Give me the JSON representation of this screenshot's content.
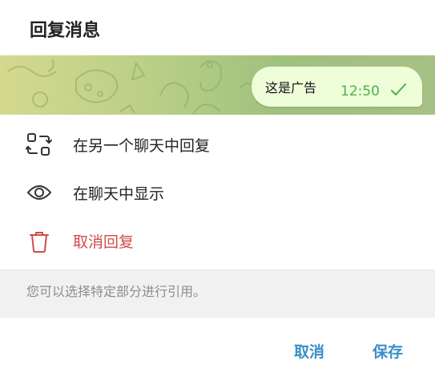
{
  "dialog": {
    "title": "回复消息"
  },
  "preview": {
    "message_text": "这是广告",
    "time": "12:50",
    "status_icon": "double-check-icon",
    "bubble_color": "#eefed9",
    "time_color": "#4fae4e"
  },
  "menu": {
    "items": [
      {
        "label": "在另一个聊天中回复",
        "icon": "reply-other-chat-icon"
      },
      {
        "label": "在聊天中显示",
        "icon": "eye-icon"
      },
      {
        "label": "取消回复",
        "icon": "trash-icon",
        "color": "#d14b4b"
      }
    ]
  },
  "hint": {
    "text": "您可以选择特定部分进行引用。"
  },
  "footer": {
    "cancel_label": "取消",
    "save_label": "保存",
    "accent_color": "#3a8fc8"
  }
}
